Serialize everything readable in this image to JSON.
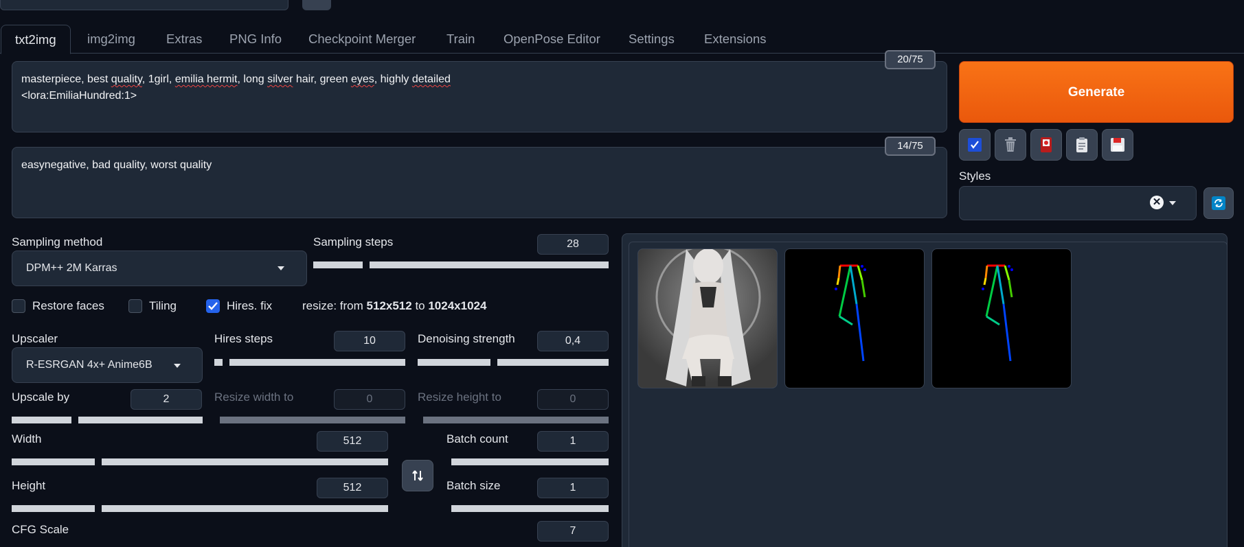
{
  "tabs": [
    "txt2img",
    "img2img",
    "Extras",
    "PNG Info",
    "Checkpoint Merger",
    "Train",
    "OpenPose Editor",
    "Settings",
    "Extensions"
  ],
  "active_tab": "txt2img",
  "prompt": {
    "segments": [
      "masterpiece, best ",
      "quality",
      ", 1girl, ",
      "emilia hermit",
      ", long ",
      "silver",
      " hair, green ",
      "eyes",
      ", highly ",
      "detailed",
      "\n<lora:EmiliaHundred:1>"
    ],
    "counter": "20/75"
  },
  "negative_prompt": {
    "text": "easynegative, bad quality, worst quality",
    "counter": "14/75"
  },
  "generate_label": "Generate",
  "styles": {
    "label": "Styles",
    "value": ""
  },
  "sampling": {
    "method_label": "Sampling method",
    "method_value": "DPM++ 2M Karras",
    "steps_label": "Sampling steps",
    "steps_value": "28",
    "steps_fraction": 0.18
  },
  "checkboxes": {
    "restore_faces": {
      "label": "Restore faces",
      "checked": false
    },
    "tiling": {
      "label": "Tiling",
      "checked": false
    },
    "hires_fix": {
      "label": "Hires. fix",
      "checked": true
    }
  },
  "resize_info": {
    "prefix": "resize: from ",
    "from": "512x512",
    "mid": " to ",
    "to": "1024x1024"
  },
  "upscaler": {
    "label": "Upscaler",
    "value": "R-ESRGAN 4x+ Anime6B"
  },
  "hires_steps": {
    "label": "Hires steps",
    "value": "10",
    "fraction": 0.06
  },
  "denoising": {
    "label": "Denoising strength",
    "value": "0,4",
    "fraction": 0.4
  },
  "upscale_by": {
    "label": "Upscale by",
    "value": "2",
    "fraction": 0.33
  },
  "resize_width": {
    "label": "Resize width to",
    "value": "0"
  },
  "resize_height": {
    "label": "Resize height to",
    "value": "0"
  },
  "width": {
    "label": "Width",
    "value": "512",
    "fraction": 0.23
  },
  "height": {
    "label": "Height",
    "value": "512",
    "fraction": 0.23
  },
  "batch_count": {
    "label": "Batch count",
    "value": "1"
  },
  "batch_size": {
    "label": "Batch size",
    "value": "1"
  },
  "cfg_scale": {
    "label": "CFG Scale",
    "value": "7"
  },
  "colors": {
    "accent": "#f97316",
    "bg": "#0b0f19",
    "panel": "#1f2937",
    "border": "#374151",
    "check": "#2563eb"
  }
}
